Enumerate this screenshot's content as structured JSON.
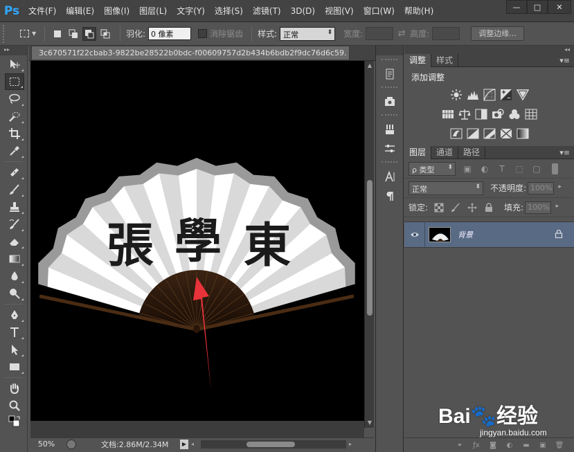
{
  "app": {
    "logo": "Ps"
  },
  "menu": [
    "文件(F)",
    "编辑(E)",
    "图像(I)",
    "图层(L)",
    "文字(Y)",
    "选择(S)",
    "滤镜(T)",
    "3D(D)",
    "视图(V)",
    "窗口(W)",
    "帮助(H)"
  ],
  "window_controls": {
    "minimize": "—",
    "maximize": "□",
    "close": "✕"
  },
  "options": {
    "feather_label": "羽化:",
    "feather_value": "0 像素",
    "antialias_label": "消除锯齿",
    "style_label": "样式:",
    "style_value": "正常",
    "width_label": "宽度:",
    "height_label": "高度:",
    "refine_edge_label": "调整边缘..."
  },
  "document": {
    "tab_title": "3c670571f22cbab3-9822be28522b0bdc-f00609757d2b434b6bdb2f9dc76d6c59.",
    "artwork_text": [
      "張",
      "學",
      "東"
    ],
    "zoom": "50%",
    "doc_info": "文档:2.86M/2.34M"
  },
  "adjustments": {
    "tabs": [
      "调整",
      "样式"
    ],
    "active_tab": "调整",
    "title": "添加调整"
  },
  "layers_panel": {
    "tabs": [
      "图层",
      "通道",
      "路径"
    ],
    "active_tab": "图层",
    "kind_label": "ρ 类型",
    "blend_mode": "正常",
    "opacity_label": "不透明度:",
    "opacity_value": "100%",
    "lock_label": "锁定:",
    "fill_label": "填充:",
    "fill_value": "100%",
    "layers": [
      {
        "name": "背景",
        "visible": true,
        "locked": true
      }
    ]
  },
  "watermark": {
    "logo": "Bai🐾经验",
    "site": "jingyan.baidu.com"
  },
  "colors": {
    "accent": "#31a8ff",
    "selected_layer": "#596a84",
    "arrow": "#e8333a"
  }
}
